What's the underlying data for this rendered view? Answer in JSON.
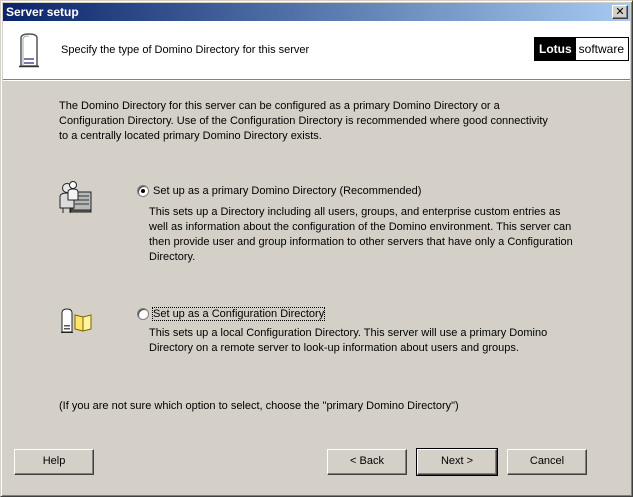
{
  "window": {
    "title": "Server setup"
  },
  "header": {
    "instruction": "Specify the type of Domino Directory for this server",
    "logo_bold": "Lotus",
    "logo_light": "software"
  },
  "intro": "The Domino Directory for this server can be configured as a primary Domino Directory or a Configuration Directory. Use of the Configuration Directory is recommended where good connectivity to a centrally located primary Domino Directory exists.",
  "options": [
    {
      "label": "Set up as a primary Domino Directory (Recommended)",
      "description": "This sets up a Directory including all users, groups, and enterprise custom entries as well as information about the configuration of the Domino environment. This server can then provide user and group information to other servers that have only a Configuration Directory.",
      "selected": true,
      "icon": "people-directory-icon"
    },
    {
      "label": "Set up as a Configuration Directory",
      "description": "This sets up a local Configuration Directory. This server will use a primary Domino Directory on a remote server to look-up information about users and groups.",
      "selected": false,
      "icon": "server-book-icon"
    }
  ],
  "note": "(If you are not sure which option to select, choose the \"primary Domino Directory\")",
  "buttons": {
    "help": "Help",
    "back": "< Back",
    "next": "Next >",
    "cancel": "Cancel"
  },
  "colors": {
    "titlebar_start": "#0a246a",
    "titlebar_end": "#a6caf0",
    "face": "#d4d0c8"
  }
}
